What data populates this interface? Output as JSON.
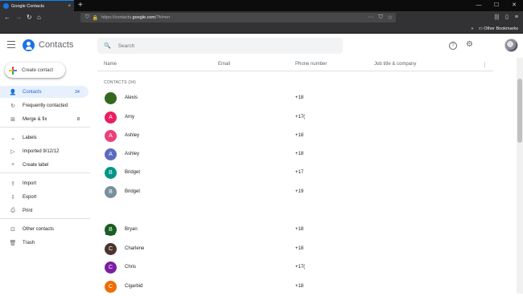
{
  "browser": {
    "tab_title": "Google Contacts",
    "tab_close": "×",
    "new_tab": "+",
    "url_prefix": "https://contacts.",
    "url_domain": "google.com",
    "url_suffix": "/?hl=en",
    "bookmarks_label": "Other Bookmarks",
    "bookmarks_chevron": "»",
    "win_min": "—",
    "win_max": "☐",
    "win_close": "✕"
  },
  "app": {
    "title": "Contacts",
    "search_placeholder": "Search"
  },
  "sidebar": {
    "create_label": "Create contact",
    "items": [
      {
        "label": "Contacts",
        "count": "34",
        "icon": "person-icon",
        "glyph": "👤"
      },
      {
        "label": "Frequently contacted",
        "count": "",
        "icon": "history-icon",
        "glyph": "↻"
      },
      {
        "label": "Merge & fix",
        "count": "8",
        "icon": "merge-icon",
        "glyph": "⊞"
      },
      {
        "label": "Labels",
        "count": "",
        "icon": "chevron-icon",
        "glyph": "⌄"
      },
      {
        "label": "Imported 9/12/12",
        "count": "",
        "icon": "label-icon",
        "glyph": "▷"
      },
      {
        "label": "Create label",
        "count": "",
        "icon": "plus-icon",
        "glyph": "+"
      },
      {
        "label": "Import",
        "count": "",
        "icon": "cloud-upload-icon",
        "glyph": "⇪"
      },
      {
        "label": "Export",
        "count": "",
        "icon": "cloud-download-icon",
        "glyph": "⇩"
      },
      {
        "label": "Print",
        "count": "",
        "icon": "print-icon",
        "glyph": "⎙"
      },
      {
        "label": "Other contacts",
        "count": "",
        "icon": "other-contacts-icon",
        "glyph": "⊡"
      },
      {
        "label": "Trash",
        "count": "",
        "icon": "trash-icon",
        "glyph": "🗑"
      }
    ]
  },
  "table": {
    "columns": [
      "Name",
      "Email",
      "Phone number",
      "Job title & company"
    ],
    "group_label": "CONTACTS (34)",
    "rows": [
      {
        "initial": "",
        "name": "Alexis",
        "phone": "+18",
        "color": "#33691e"
      },
      {
        "initial": "A",
        "name": "Amy",
        "phone": "+17(",
        "color": "#e91e63"
      },
      {
        "initial": "A",
        "name": "Ashley",
        "phone": "+18",
        "color": "#ec407a"
      },
      {
        "initial": "A",
        "name": "Ashley",
        "phone": "+18",
        "color": "#5c6bc0"
      },
      {
        "initial": "B",
        "name": "Bridget",
        "phone": "+17",
        "color": "#009688"
      },
      {
        "initial": "B",
        "name": "Bridget",
        "phone": "+19",
        "color": "#78909c"
      },
      {
        "initial": "B",
        "name": "Bryan",
        "phone": "+18",
        "color": "#1b5e20"
      },
      {
        "initial": "C",
        "name": "Charlene",
        "phone": "+18",
        "color": "#4e342e"
      },
      {
        "initial": "C",
        "name": "Chris",
        "phone": "+17(",
        "color": "#7b1fa2"
      },
      {
        "initial": "C",
        "name": "Cigarbid",
        "phone": "+18",
        "color": "#ef6c00"
      }
    ]
  },
  "colors": {
    "accent": "#1a73e8",
    "active_bg": "#e8f0fe"
  }
}
